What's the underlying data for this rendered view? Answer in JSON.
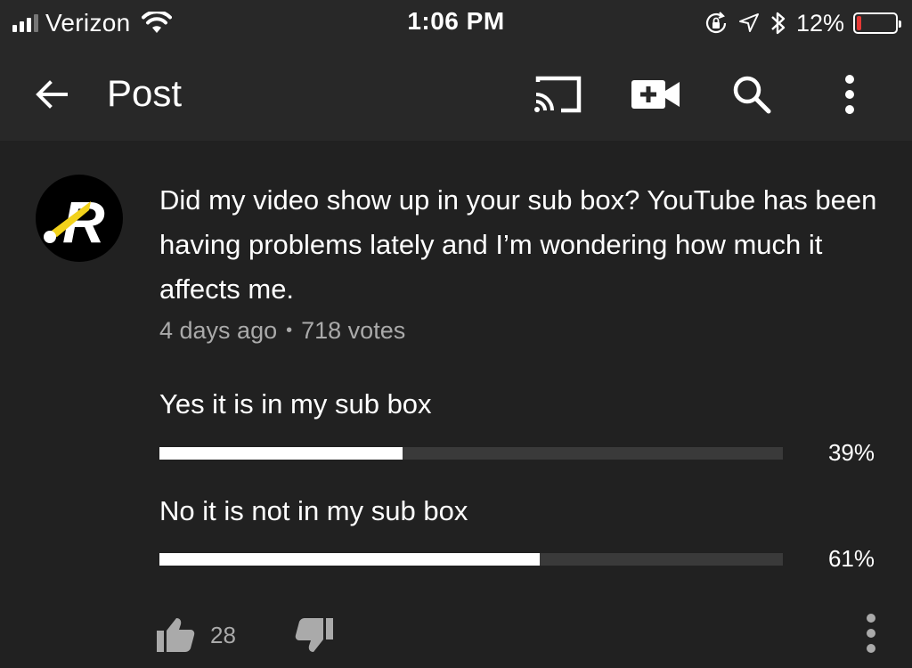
{
  "status_bar": {
    "carrier": "Verizon",
    "time": "1:06 PM",
    "battery_percent": "12%",
    "battery_level": 0.12,
    "signal_bars": 3,
    "battery_color": "#e53935"
  },
  "app_bar": {
    "title": "Post",
    "icons": [
      "back-arrow-icon",
      "cast-icon",
      "create-video-icon",
      "search-icon",
      "more-vert-icon"
    ]
  },
  "post": {
    "text": "Did my video show up in your sub box? YouTube has been having problems lately and I’m wondering how much it affects me.",
    "age": "4 days ago",
    "separator": "•",
    "votes": "718 votes",
    "options": [
      {
        "label": "Yes it is in my sub box",
        "percent_label": "39%",
        "fraction": 0.39
      },
      {
        "label": "No it is not in my sub box",
        "percent_label": "61%",
        "fraction": 0.61
      }
    ],
    "likes": "28"
  }
}
